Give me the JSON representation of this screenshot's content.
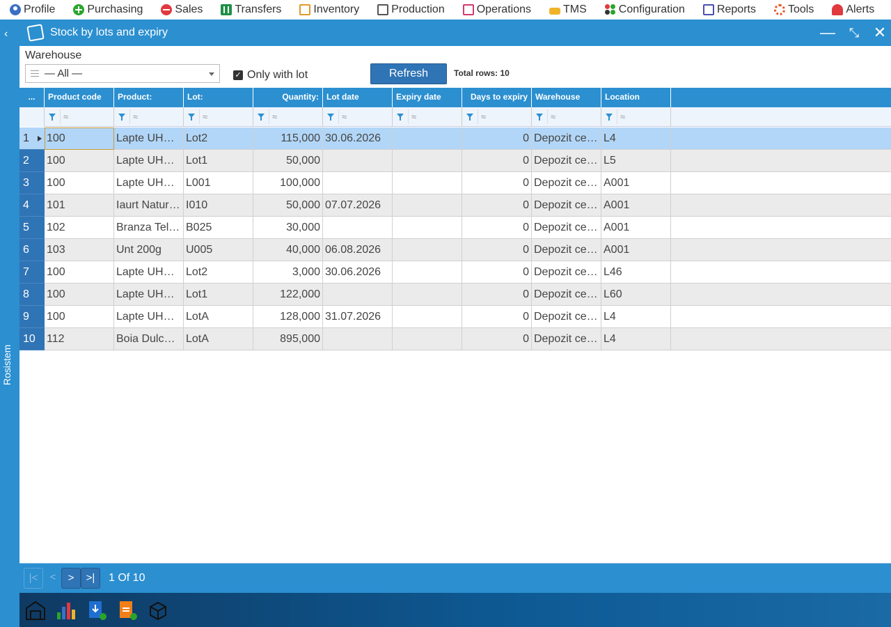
{
  "menu": [
    {
      "label": "Profile",
      "icon": "profile-icon"
    },
    {
      "label": "Purchasing",
      "icon": "plus-circle-icon"
    },
    {
      "label": "Sales",
      "icon": "minus-circle-icon"
    },
    {
      "label": "Transfers",
      "icon": "transfers-icon"
    },
    {
      "label": "Inventory",
      "icon": "inventory-icon"
    },
    {
      "label": "Production",
      "icon": "production-icon"
    },
    {
      "label": "Operations",
      "icon": "operations-icon"
    },
    {
      "label": "TMS",
      "icon": "truck-icon"
    },
    {
      "label": "Configuration",
      "icon": "configuration-icon"
    },
    {
      "label": "Reports",
      "icon": "reports-icon"
    },
    {
      "label": "Tools",
      "icon": "gear-icon"
    },
    {
      "label": "Alerts",
      "icon": "bell-icon"
    }
  ],
  "sidebar": {
    "label": "Rosistem"
  },
  "window": {
    "title": "Stock by lots and expiry"
  },
  "filters": {
    "warehouse_label": "Warehouse",
    "warehouse_value": "— All —",
    "only_with_lot_label": "Only with lot",
    "only_with_lot_checked": true,
    "refresh_label": "Refresh",
    "total_rows": "Total rows: 10"
  },
  "grid": {
    "corner": "...",
    "filter_placeholder": "≈",
    "columns": [
      "Product code",
      "Product:",
      "Lot:",
      "Quantity:",
      "Lot date",
      "Expiry date",
      "Days to expiry",
      "Warehouse",
      "Location"
    ],
    "rows": [
      {
        "n": "1",
        "code": "100",
        "product": "Lapte UHT…",
        "lot": "Lot2",
        "qty": "115,000",
        "lot_date": "30.06.2026",
        "expiry": "",
        "days": "0",
        "wh": "Depozit ce…",
        "loc": "L4"
      },
      {
        "n": "2",
        "code": "100",
        "product": "Lapte UHT…",
        "lot": "Lot1",
        "qty": "50,000",
        "lot_date": "",
        "expiry": "",
        "days": "0",
        "wh": "Depozit ce…",
        "loc": "L5"
      },
      {
        "n": "3",
        "code": "100",
        "product": "Lapte UHT…",
        "lot": "L001",
        "qty": "100,000",
        "lot_date": "",
        "expiry": "",
        "days": "0",
        "wh": "Depozit ce…",
        "loc": "A001"
      },
      {
        "n": "4",
        "code": "101",
        "product": "Iaurt Natur…",
        "lot": "I010",
        "qty": "50,000",
        "lot_date": "07.07.2026",
        "expiry": "",
        "days": "0",
        "wh": "Depozit ce…",
        "loc": "A001"
      },
      {
        "n": "5",
        "code": "102",
        "product": "Branza Tel…",
        "lot": "B025",
        "qty": "30,000",
        "lot_date": "",
        "expiry": "",
        "days": "0",
        "wh": "Depozit ce…",
        "loc": "A001"
      },
      {
        "n": "6",
        "code": "103",
        "product": "Unt 200g",
        "lot": "U005",
        "qty": "40,000",
        "lot_date": "06.08.2026",
        "expiry": "",
        "days": "0",
        "wh": "Depozit ce…",
        "loc": "A001"
      },
      {
        "n": "7",
        "code": "100",
        "product": "Lapte UHT…",
        "lot": "Lot2",
        "qty": "3,000",
        "lot_date": "30.06.2026",
        "expiry": "",
        "days": "0",
        "wh": "Depozit ce…",
        "loc": "L46"
      },
      {
        "n": "8",
        "code": "100",
        "product": "Lapte UHT…",
        "lot": "Lot1",
        "qty": "122,000",
        "lot_date": "",
        "expiry": "",
        "days": "0",
        "wh": "Depozit ce…",
        "loc": "L60"
      },
      {
        "n": "9",
        "code": "100",
        "product": "Lapte UHT…",
        "lot": "LotA",
        "qty": "128,000",
        "lot_date": "31.07.2026",
        "expiry": "",
        "days": "0",
        "wh": "Depozit ce…",
        "loc": "L4"
      },
      {
        "n": "10",
        "code": "112",
        "product": "Boia Dulce…",
        "lot": "LotA",
        "qty": "895,000",
        "lot_date": "",
        "expiry": "",
        "days": "0",
        "wh": "Depozit ce…",
        "loc": "L4"
      }
    ]
  },
  "pager": {
    "first": "|<",
    "prev": "<",
    "next": ">",
    "last": ">|",
    "info": "1 Of 10"
  },
  "colors": {
    "accent": "#2b8fd0",
    "dark_accent": "#2f74b5",
    "selected_row": "#b2d6f7"
  }
}
